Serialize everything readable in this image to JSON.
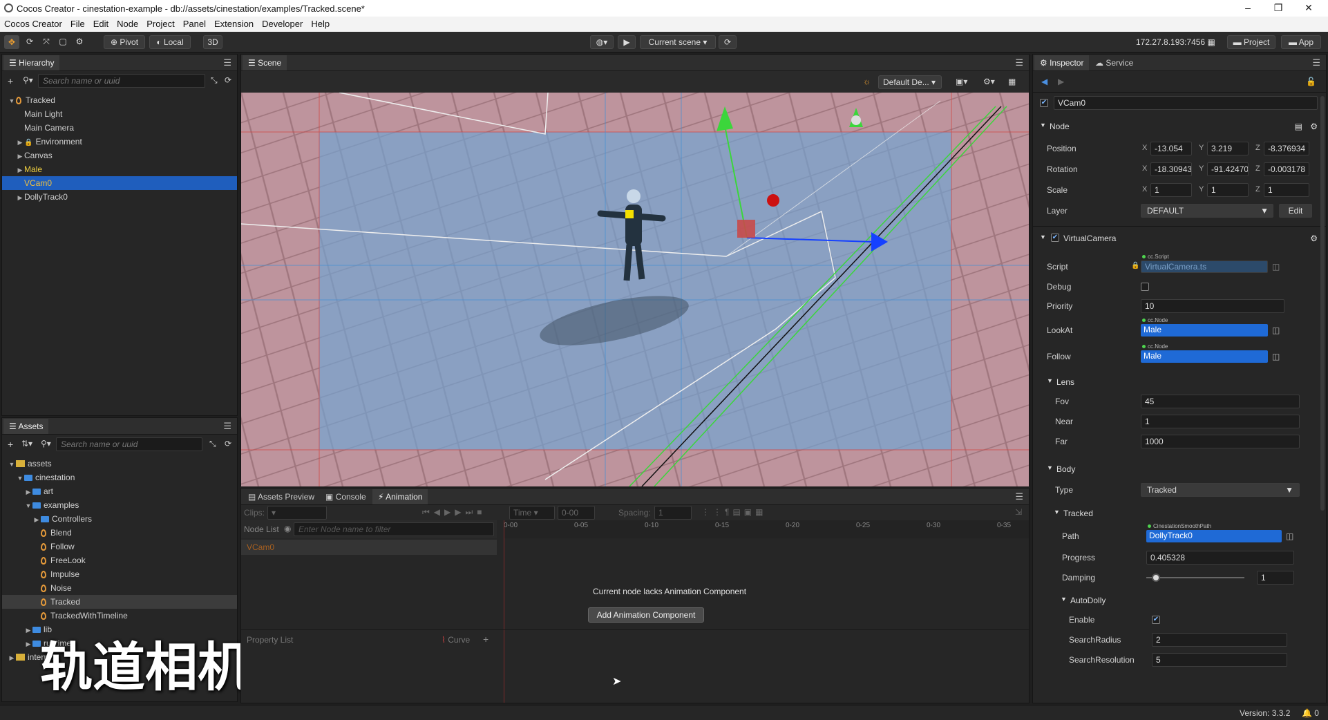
{
  "window": {
    "title": "Cocos Creator - cinestation-example - db://assets/cinestation/examples/Tracked.scene*",
    "min": "–",
    "max": "❐",
    "close": "✕"
  },
  "menu": [
    "Cocos Creator",
    "File",
    "Edit",
    "Node",
    "Project",
    "Panel",
    "Extension",
    "Developer",
    "Help"
  ],
  "toolbar": {
    "pivot": "Pivot",
    "local": "Local",
    "mode3d": "3D",
    "current_scene": "Current scene",
    "ip": "172.27.8.193:7456",
    "project": "Project",
    "app": "App"
  },
  "hierarchy": {
    "tab": "Hierarchy",
    "search_placeholder": "Search name or uuid",
    "items": [
      {
        "label": "Tracked",
        "indent": 0,
        "arrow": "▼",
        "icon": "flame"
      },
      {
        "label": "Main Light",
        "indent": 1,
        "arrow": "",
        "icon": ""
      },
      {
        "label": "Main Camera",
        "indent": 1,
        "arrow": "",
        "icon": ""
      },
      {
        "label": "Environment",
        "indent": 1,
        "arrow": "▶",
        "icon": "lock"
      },
      {
        "label": "Canvas",
        "indent": 1,
        "arrow": "▶",
        "icon": ""
      },
      {
        "label": "Male",
        "indent": 1,
        "arrow": "▶",
        "icon": "",
        "color": "#f0d040"
      },
      {
        "label": "VCam0",
        "indent": 1,
        "arrow": "",
        "icon": "",
        "selected": true
      },
      {
        "label": "DollyTrack0",
        "indent": 1,
        "arrow": "▶",
        "icon": ""
      }
    ]
  },
  "assets": {
    "tab": "Assets",
    "search_placeholder": "Search name or uuid",
    "items": [
      {
        "label": "assets",
        "indent": 0,
        "arrow": "▼",
        "icon": "db"
      },
      {
        "label": "cinestation",
        "indent": 1,
        "arrow": "▼",
        "icon": "folder"
      },
      {
        "label": "art",
        "indent": 2,
        "arrow": "▶",
        "icon": "folder"
      },
      {
        "label": "examples",
        "indent": 2,
        "arrow": "▼",
        "icon": "folder"
      },
      {
        "label": "Controllers",
        "indent": 3,
        "arrow": "▶",
        "icon": "folder"
      },
      {
        "label": "Blend",
        "indent": 3,
        "arrow": "",
        "icon": "flame"
      },
      {
        "label": "Follow",
        "indent": 3,
        "arrow": "",
        "icon": "flame"
      },
      {
        "label": "FreeLook",
        "indent": 3,
        "arrow": "",
        "icon": "flame"
      },
      {
        "label": "Impulse",
        "indent": 3,
        "arrow": "",
        "icon": "flame"
      },
      {
        "label": "Noise",
        "indent": 3,
        "arrow": "",
        "icon": "flame"
      },
      {
        "label": "Tracked",
        "indent": 3,
        "arrow": "",
        "icon": "flame",
        "highlight": true
      },
      {
        "label": "TrackedWithTimeline",
        "indent": 3,
        "arrow": "",
        "icon": "flame"
      },
      {
        "label": "lib",
        "indent": 2,
        "arrow": "▶",
        "icon": "folder"
      },
      {
        "label": "runtime",
        "indent": 2,
        "arrow": "▶",
        "icon": "folder"
      },
      {
        "label": "internal",
        "indent": 0,
        "arrow": "▶",
        "icon": "db"
      }
    ]
  },
  "overlay_caption": "轨道相机",
  "scene": {
    "tab": "Scene",
    "camera_dropdown": "Default De..."
  },
  "bottom": {
    "tabs": [
      "Assets Preview",
      "Console",
      "Animation"
    ],
    "clips_label": "Clips:",
    "time_label": "Time",
    "time_value": "0-00",
    "spacing_label": "Spacing:",
    "spacing_value": "1",
    "node_list_label": "Node List",
    "node_filter_placeholder": "Enter Node name to filter",
    "ticks": [
      "0-00",
      "0-05",
      "0-10",
      "0-15",
      "0-20",
      "0-25",
      "0-30",
      "0-35"
    ],
    "node_name": "VCam0",
    "message": "Current node lacks Animation Component",
    "add_button": "Add Animation Component",
    "property_list": "Property List",
    "curve": "Curve"
  },
  "inspector": {
    "tabs": [
      "Inspector",
      "Service"
    ],
    "node_name": "VCam0",
    "node_section": "Node",
    "position_label": "Position",
    "position": [
      "-13.054",
      "3.219",
      "-8.376934"
    ],
    "rotation_label": "Rotation",
    "rotation": [
      "-18.30943",
      "-91.42470",
      "-0.003178"
    ],
    "scale_label": "Scale",
    "scale": [
      "1",
      "1",
      "1"
    ],
    "layer_label": "Layer",
    "layer_value": "DEFAULT",
    "edit_button": "Edit",
    "vc_section": "VirtualCamera",
    "script_label": "Script",
    "script_tag": "cc.Script",
    "script_value": "VirtualCamera.ts",
    "debug_label": "Debug",
    "priority_label": "Priority",
    "priority_value": "10",
    "lookat_label": "LookAt",
    "lookat_tag": "cc.Node",
    "lookat_value": "Male",
    "follow_label": "Follow",
    "follow_tag": "cc.Node",
    "follow_value": "Male",
    "lens_section": "Lens",
    "fov_label": "Fov",
    "fov_value": "45",
    "near_label": "Near",
    "near_value": "1",
    "far_label": "Far",
    "far_value": "1000",
    "body_section": "Body",
    "type_label": "Type",
    "type_value": "Tracked",
    "tracked_section": "Tracked",
    "path_label": "Path",
    "path_tag": "CinestationSmoothPath",
    "path_value": "DollyTrack0",
    "progress_label": "Progress",
    "progress_value": "0.405328",
    "damping_label": "Damping",
    "damping_value": "1",
    "damping_slider": 0.1,
    "autodolly_section": "AutoDolly",
    "enable_label": "Enable",
    "searchradius_label": "SearchRadius",
    "searchradius_value": "2",
    "searchres_label": "SearchResolution",
    "searchres_value": "5"
  },
  "status": {
    "version": "Version: 3.3.2",
    "notifications": "0"
  }
}
